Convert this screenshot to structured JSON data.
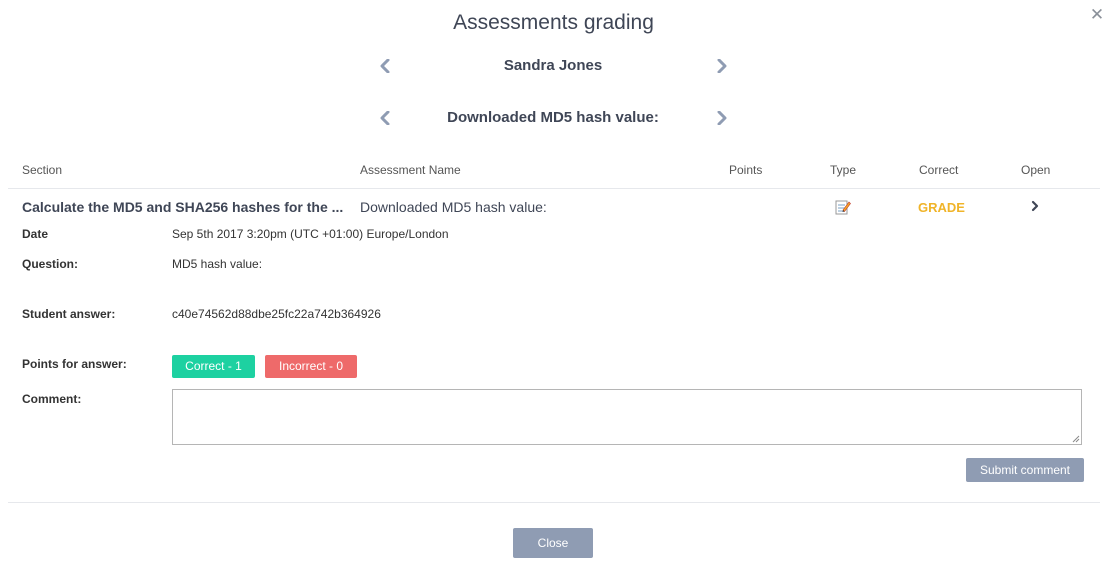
{
  "header": {
    "title": "Assessments grading",
    "close_icon": "close-icon"
  },
  "student_nav": {
    "name": "Sandra Jones",
    "prev_icon": "chevron-left-icon",
    "next_icon": "chevron-right-icon"
  },
  "question_nav": {
    "label": "Downloaded MD5 hash value:",
    "prev_icon": "chevron-left-icon",
    "next_icon": "chevron-right-icon"
  },
  "table": {
    "columns": [
      "Section",
      "Assessment Name",
      "Points",
      "Type",
      "Correct",
      "Open"
    ],
    "row": {
      "section": "Calculate the MD5 and SHA256 hashes for the ...",
      "assessment_name": "Downloaded MD5 hash value:",
      "points": "",
      "type_icon": "edit-note-icon",
      "correct": "GRADE",
      "open_icon": "chevron-right-icon"
    }
  },
  "details": {
    "date_label": "Date",
    "date_value": "Sep 5th 2017 3:20pm (UTC +01:00) Europe/London",
    "question_label": "Question:",
    "question_value": "MD5 hash value:",
    "answer_label": "Student answer:",
    "answer_value": "c40e74562d88dbe25fc22a742b364926",
    "points_label": "Points for answer:",
    "correct_button": "Correct - 1",
    "incorrect_button": "Incorrect - 0",
    "comment_label": "Comment:",
    "comment_value": "",
    "submit_button": "Submit comment"
  },
  "footer": {
    "close_button": "Close"
  },
  "colors": {
    "title": "#3f4656",
    "correct_btn": "#1dd1a1",
    "incorrect_btn": "#ee6a6a",
    "neutral_btn": "#8f9cb3",
    "grade_text": "#f0b429"
  }
}
